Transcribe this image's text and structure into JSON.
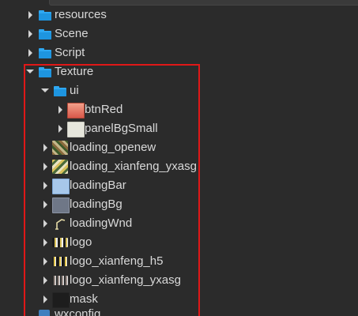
{
  "tree": {
    "items": [
      {
        "label": "resources",
        "kind": "folder",
        "depth": 0,
        "expanded": false,
        "icon": "folder-icon"
      },
      {
        "label": "Scene",
        "kind": "folder",
        "depth": 0,
        "expanded": false,
        "icon": "folder-icon"
      },
      {
        "label": "Script",
        "kind": "folder",
        "depth": 0,
        "expanded": false,
        "icon": "folder-icon"
      },
      {
        "label": "Texture",
        "kind": "folder",
        "depth": 0,
        "expanded": true,
        "icon": "folder-icon"
      },
      {
        "label": "ui",
        "kind": "folder",
        "depth": 1,
        "expanded": true,
        "icon": "folder-icon"
      },
      {
        "label": "btnRed",
        "kind": "texture",
        "depth": 2,
        "expanded": false,
        "icon": "red-button-texture-icon"
      },
      {
        "label": "panelBgSmall",
        "kind": "texture",
        "depth": 2,
        "expanded": false,
        "icon": "panel-background-texture-icon"
      },
      {
        "label": "loading_openew",
        "kind": "texture",
        "depth": 1,
        "expanded": false,
        "icon": "image-texture-icon"
      },
      {
        "label": "loading_xianfeng_yxasg",
        "kind": "texture",
        "depth": 1,
        "expanded": false,
        "icon": "image-texture-icon"
      },
      {
        "label": "loadingBar",
        "kind": "texture",
        "depth": 1,
        "expanded": false,
        "icon": "bar-texture-icon"
      },
      {
        "label": "loadingBg",
        "kind": "texture",
        "depth": 1,
        "expanded": false,
        "icon": "background-texture-icon"
      },
      {
        "label": "loadingWnd",
        "kind": "texture",
        "depth": 1,
        "expanded": false,
        "icon": "window-texture-icon"
      },
      {
        "label": "logo",
        "kind": "texture",
        "depth": 1,
        "expanded": false,
        "icon": "logo-texture-icon"
      },
      {
        "label": "logo_xianfeng_h5",
        "kind": "texture",
        "depth": 1,
        "expanded": false,
        "icon": "logo-texture-icon"
      },
      {
        "label": "logo_xianfeng_yxasg",
        "kind": "texture",
        "depth": 1,
        "expanded": false,
        "icon": "logo-texture-icon"
      },
      {
        "label": "mask",
        "kind": "texture",
        "depth": 1,
        "expanded": false,
        "icon": "mask-texture-icon"
      },
      {
        "label": "wxconfig",
        "kind": "file",
        "depth": 0,
        "expanded": false,
        "icon": "config-file-icon"
      }
    ]
  },
  "colors": {
    "background": "#2b2b2b",
    "text": "#d9d9d9",
    "folder": "#2ea8f2",
    "highlight_box": "#e01818"
  }
}
